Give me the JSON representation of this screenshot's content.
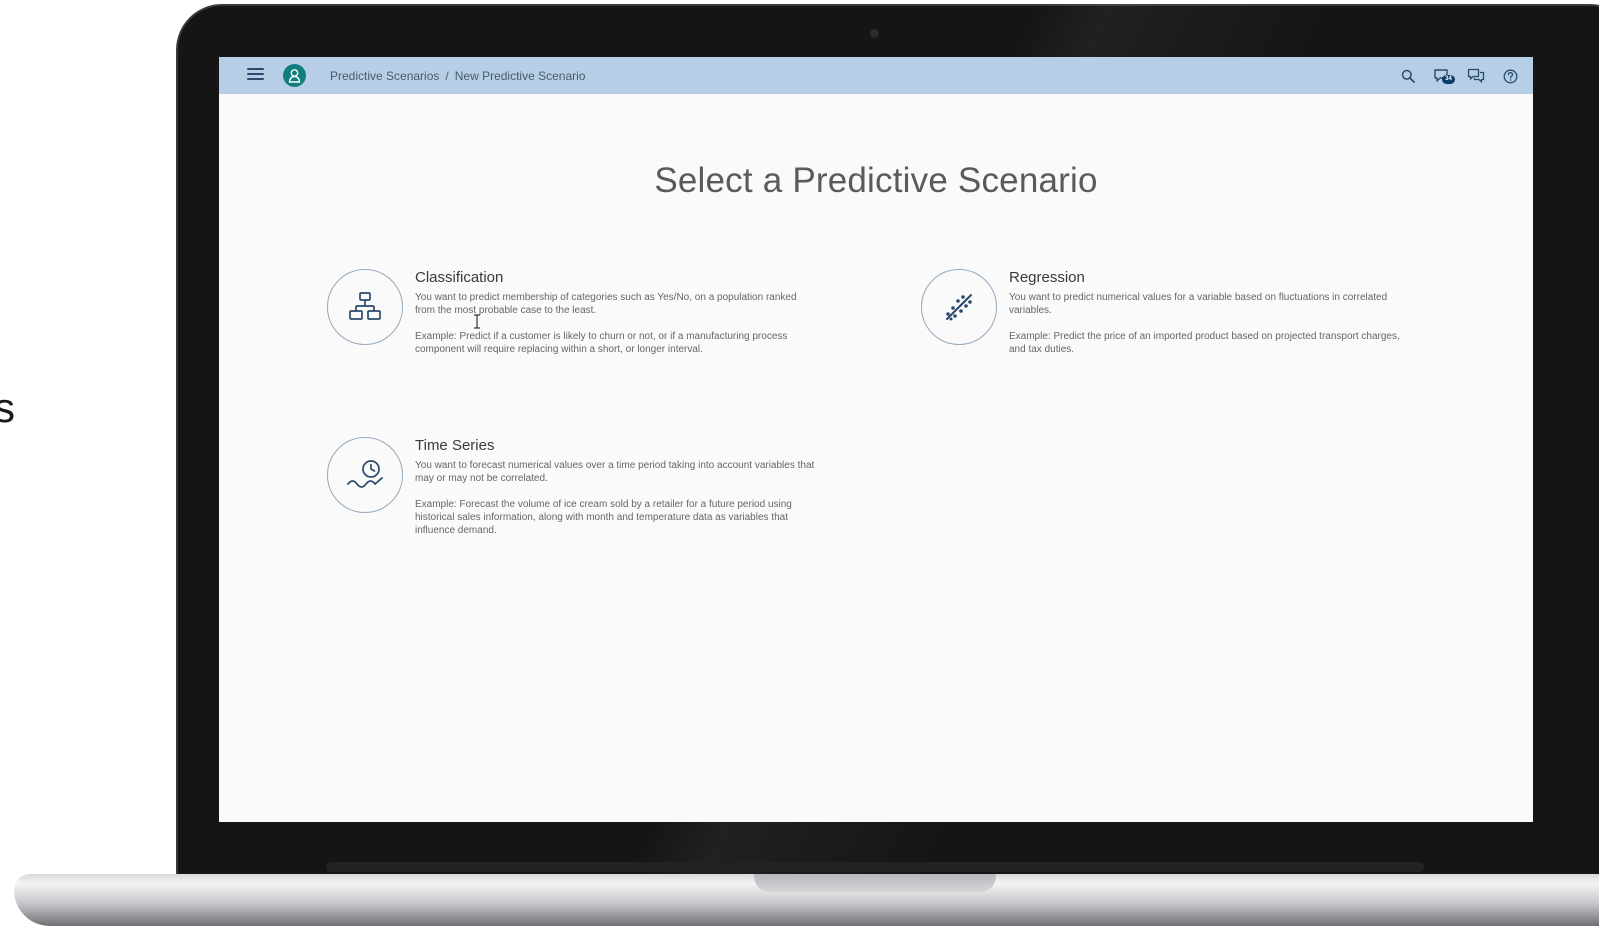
{
  "background": {
    "cut_letter": "s"
  },
  "shellbar": {
    "breadcrumb_root": "Predictive Scenarios",
    "breadcrumb_separator": "/",
    "breadcrumb_current": "New Predictive Scenario",
    "notification_count": "34",
    "bar_color": "#b6cfe6",
    "avatar_color": "#107e7d",
    "icons": [
      "menu-icon",
      "user-icon",
      "search-icon",
      "notifications-icon",
      "feedback-icon",
      "help-icon"
    ]
  },
  "main": {
    "title": "Select a Predictive Scenario",
    "scenarios": [
      {
        "icon": "hierarchy-icon",
        "title": "Classification",
        "description": "You want to predict membership of categories such as Yes/No, on a population ranked from the most probable case to the least.",
        "example": "Example: Predict if a customer is likely to churn or not, or if a manufacturing process component will require replacing within a short, or longer interval."
      },
      {
        "icon": "regression-icon",
        "title": "Regression",
        "description": "You want to predict numerical values for a variable based on fluctuations in correlated variables.",
        "example": "Example: Predict the price of an imported product based on projected transport charges, and tax duties."
      },
      {
        "icon": "time-series-icon",
        "title": "Time Series",
        "description": "You want to forecast numerical values over a time period taking into account variables that may or may not be correlated.",
        "example": "Example: Forecast the volume of ice cream sold by a retailer for a future period using historical sales information, along with month and temperature data as variables that influence demand."
      }
    ]
  }
}
